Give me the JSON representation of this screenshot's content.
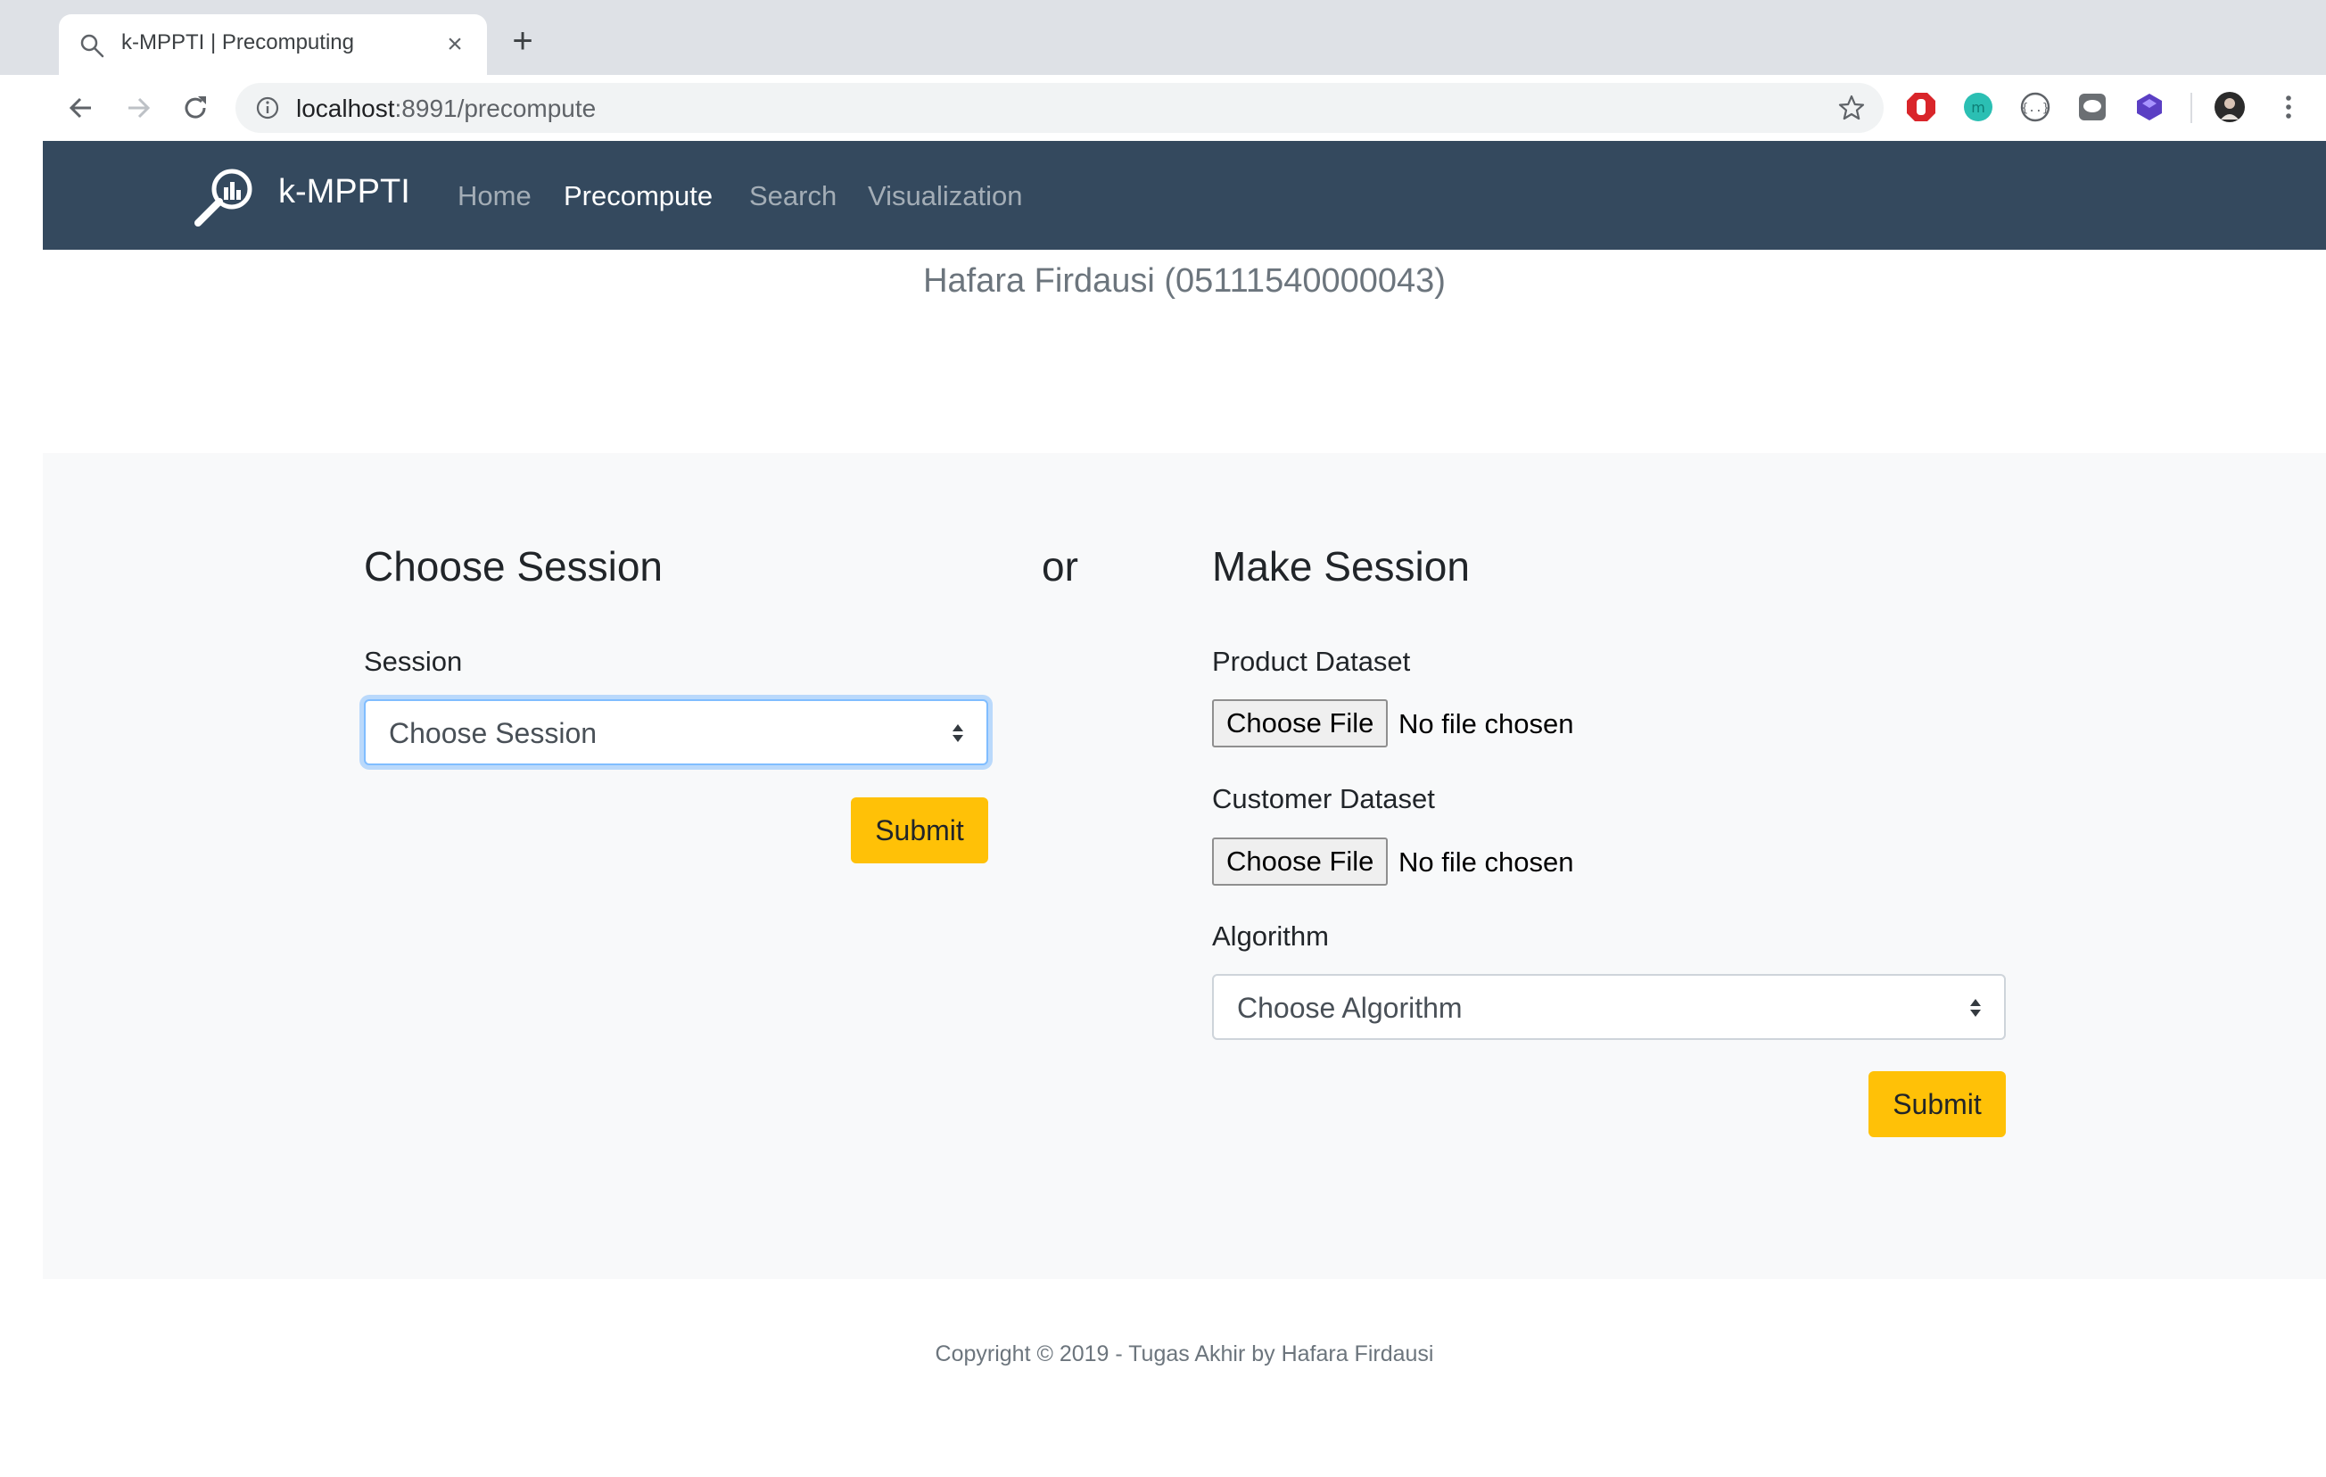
{
  "browser": {
    "tab_title": "k-MPPTI | Precomputing",
    "url_host": "localhost",
    "url_rest": ":8991/precompute"
  },
  "navbar": {
    "brand": "k-MPPTI",
    "links": [
      "Home",
      "Precompute",
      "Search",
      "Visualization"
    ],
    "active": "Precompute"
  },
  "author": "Hafara Firdausi (05111540000043)",
  "choose": {
    "heading": "Choose Session",
    "session_label": "Session",
    "session_value": "Choose Session",
    "submit": "Submit"
  },
  "or_text": "or",
  "make": {
    "heading": "Make Session",
    "product_label": "Product Dataset",
    "customer_label": "Customer Dataset",
    "file_button": "Choose File",
    "file_status": "No file chosen",
    "algorithm_label": "Algorithm",
    "algorithm_value": "Choose Algorithm",
    "submit": "Submit"
  },
  "footer": "Copyright © 2019 - Tugas Akhir by Hafara Firdausi",
  "colors": {
    "navbar": "#34495e",
    "button": "#ffc107",
    "section_bg": "#f8f9fa"
  }
}
